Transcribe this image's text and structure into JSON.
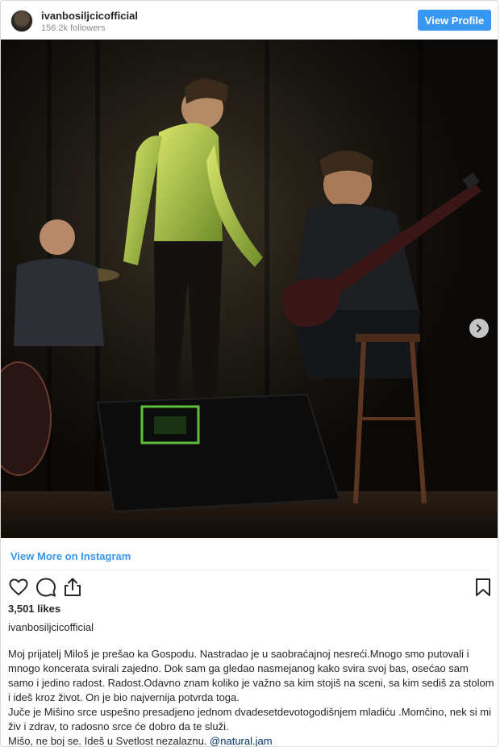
{
  "header": {
    "username": "ivanbosiljcicofficial",
    "followers": "156.2k followers",
    "view_profile_label": "View Profile"
  },
  "photo": {
    "next_icon": "chevron-right-icon"
  },
  "post": {
    "view_more_label": "View More on Instagram",
    "actions": {
      "like_icon": "heart-icon",
      "comment_icon": "comment-icon",
      "share_icon": "share-icon",
      "save_icon": "bookmark-icon"
    },
    "likes": "3,501 likes",
    "caption_username": "ivanbosiljcicofficial",
    "caption_lines": [
      "Moj prijatelj Miloš je prešao ka Gospodu. Nastradao je u saobraćajnoj nesreći.Mnogo smo putovali i mnogo koncerata svirali zajedno. Dok sam ga gledao nasmejanog kako svira svoj bas, osećao sam samo i jedino radost. Radost.Odavno znam koliko je važno sa kim stojiš na sceni, sa kim sediš za stolom i ideš kroz život. On je bio najvernija potvrda toga.",
      "Juče je Mišino srce uspešno presadjeno jednom dvadesetdevotogodišnjem mladiću .Momčino, nek si mi živ i zdrav, to radosno srce će dobro da te služi."
    ],
    "caption_last_line": "Mišo, ne boj se. Ideš u Svetlost nezalaznu.",
    "mention": "@natural.jam"
  },
  "colors": {
    "accent": "#3897f0",
    "text": "#262626",
    "muted": "#8e8e8e",
    "border": "#dbdbdb"
  }
}
